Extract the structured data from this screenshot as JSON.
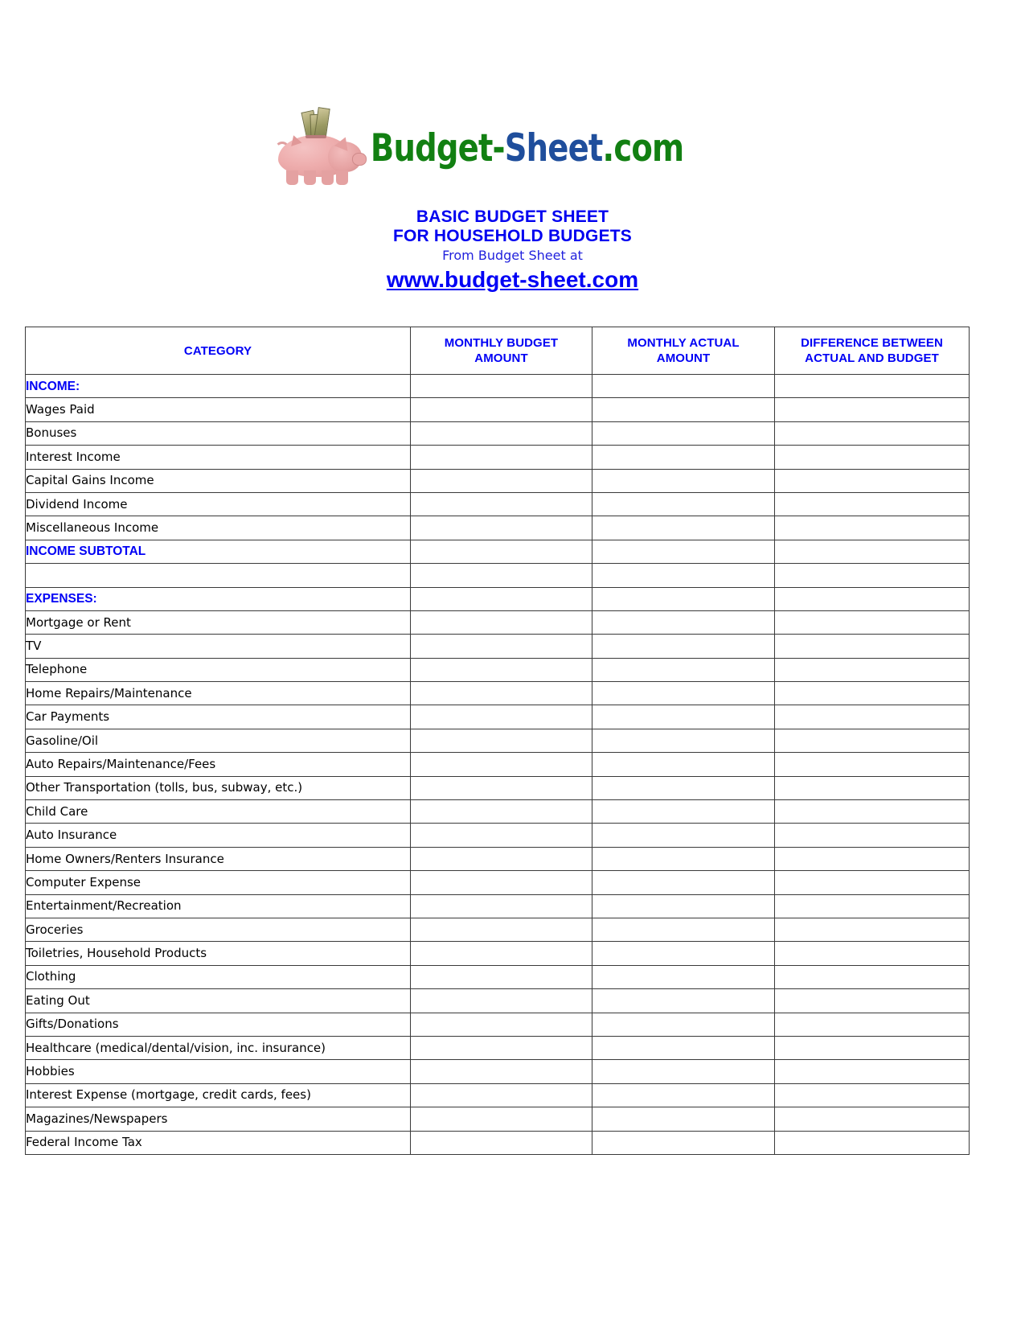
{
  "logo": {
    "alt": "piggy-bank-with-cash-logo",
    "text_green_1": "Budget-",
    "text_blue": "Sheet",
    "text_green_2": ".com"
  },
  "header": {
    "title_line1": "BASIC BUDGET SHEET",
    "title_line2": "FOR HOUSEHOLD BUDGETS",
    "subtitle": "From Budget Sheet at",
    "url": "www.budget-sheet.com",
    "title_color": "#0000f5",
    "logo_green": "#128012",
    "logo_blue": "#1f4e9c"
  },
  "table": {
    "columns": [
      {
        "key": "category",
        "label_line1": "CATEGORY",
        "label_line2": ""
      },
      {
        "key": "monthly_budget",
        "label_line1": "MONTHLY BUDGET",
        "label_line2": "AMOUNT"
      },
      {
        "key": "monthly_actual",
        "label_line1": "MONTHLY ACTUAL",
        "label_line2": "AMOUNT"
      },
      {
        "key": "difference",
        "label_line1": "DIFFERENCE BETWEEN",
        "label_line2": "ACTUAL AND BUDGET"
      }
    ],
    "rows": [
      {
        "label": "INCOME:",
        "type": "section",
        "monthly_budget": "",
        "monthly_actual": "",
        "difference": ""
      },
      {
        "label": "Wages Paid",
        "type": "item",
        "monthly_budget": "",
        "monthly_actual": "",
        "difference": ""
      },
      {
        "label": "Bonuses",
        "type": "item",
        "monthly_budget": "",
        "monthly_actual": "",
        "difference": ""
      },
      {
        "label": "Interest Income",
        "type": "item",
        "monthly_budget": "",
        "monthly_actual": "",
        "difference": ""
      },
      {
        "label": "Capital Gains Income",
        "type": "item",
        "monthly_budget": "",
        "monthly_actual": "",
        "difference": ""
      },
      {
        "label": "Dividend Income",
        "type": "item",
        "monthly_budget": "",
        "monthly_actual": "",
        "difference": ""
      },
      {
        "label": "Miscellaneous Income",
        "type": "item",
        "monthly_budget": "",
        "monthly_actual": "",
        "difference": ""
      },
      {
        "label": "INCOME SUBTOTAL",
        "type": "section",
        "monthly_budget": "",
        "monthly_actual": "",
        "difference": ""
      },
      {
        "label": "",
        "type": "spacer",
        "monthly_budget": "",
        "monthly_actual": "",
        "difference": ""
      },
      {
        "label": "EXPENSES:",
        "type": "section",
        "monthly_budget": "",
        "monthly_actual": "",
        "difference": ""
      },
      {
        "label": "Mortgage or Rent",
        "type": "item",
        "monthly_budget": "",
        "monthly_actual": "",
        "difference": ""
      },
      {
        "label": "TV",
        "type": "item",
        "monthly_budget": "",
        "monthly_actual": "",
        "difference": ""
      },
      {
        "label": "Telephone",
        "type": "item",
        "monthly_budget": "",
        "monthly_actual": "",
        "difference": ""
      },
      {
        "label": "Home Repairs/Maintenance",
        "type": "item",
        "monthly_budget": "",
        "monthly_actual": "",
        "difference": ""
      },
      {
        "label": "Car Payments",
        "type": "item",
        "monthly_budget": "",
        "monthly_actual": "",
        "difference": ""
      },
      {
        "label": "Gasoline/Oil",
        "type": "item",
        "monthly_budget": "",
        "monthly_actual": "",
        "difference": ""
      },
      {
        "label": "Auto Repairs/Maintenance/Fees",
        "type": "item",
        "monthly_budget": "",
        "monthly_actual": "",
        "difference": ""
      },
      {
        "label": "Other Transportation (tolls, bus, subway, etc.)",
        "type": "item",
        "monthly_budget": "",
        "monthly_actual": "",
        "difference": ""
      },
      {
        "label": "Child Care",
        "type": "item",
        "monthly_budget": "",
        "monthly_actual": "",
        "difference": ""
      },
      {
        "label": "Auto Insurance",
        "type": "item",
        "monthly_budget": "",
        "monthly_actual": "",
        "difference": ""
      },
      {
        "label": "Home Owners/Renters Insurance",
        "type": "item",
        "monthly_budget": "",
        "monthly_actual": "",
        "difference": ""
      },
      {
        "label": "Computer Expense",
        "type": "item",
        "monthly_budget": "",
        "monthly_actual": "",
        "difference": ""
      },
      {
        "label": "Entertainment/Recreation",
        "type": "item",
        "monthly_budget": "",
        "monthly_actual": "",
        "difference": ""
      },
      {
        "label": "Groceries",
        "type": "item",
        "monthly_budget": "",
        "monthly_actual": "",
        "difference": ""
      },
      {
        "label": "Toiletries, Household Products",
        "type": "item",
        "monthly_budget": "",
        "monthly_actual": "",
        "difference": ""
      },
      {
        "label": "Clothing",
        "type": "item",
        "monthly_budget": "",
        "monthly_actual": "",
        "difference": ""
      },
      {
        "label": "Eating Out",
        "type": "item",
        "monthly_budget": "",
        "monthly_actual": "",
        "difference": ""
      },
      {
        "label": "Gifts/Donations",
        "type": "item",
        "monthly_budget": "",
        "monthly_actual": "",
        "difference": ""
      },
      {
        "label": "Healthcare (medical/dental/vision, inc. insurance)",
        "type": "item",
        "monthly_budget": "",
        "monthly_actual": "",
        "difference": ""
      },
      {
        "label": "Hobbies",
        "type": "item",
        "monthly_budget": "",
        "monthly_actual": "",
        "difference": ""
      },
      {
        "label": "Interest Expense (mortgage, credit cards, fees)",
        "type": "item",
        "monthly_budget": "",
        "monthly_actual": "",
        "difference": ""
      },
      {
        "label": "Magazines/Newspapers",
        "type": "item",
        "monthly_budget": "",
        "monthly_actual": "",
        "difference": ""
      },
      {
        "label": "Federal Income Tax",
        "type": "item",
        "monthly_budget": "",
        "monthly_actual": "",
        "difference": ""
      }
    ]
  }
}
